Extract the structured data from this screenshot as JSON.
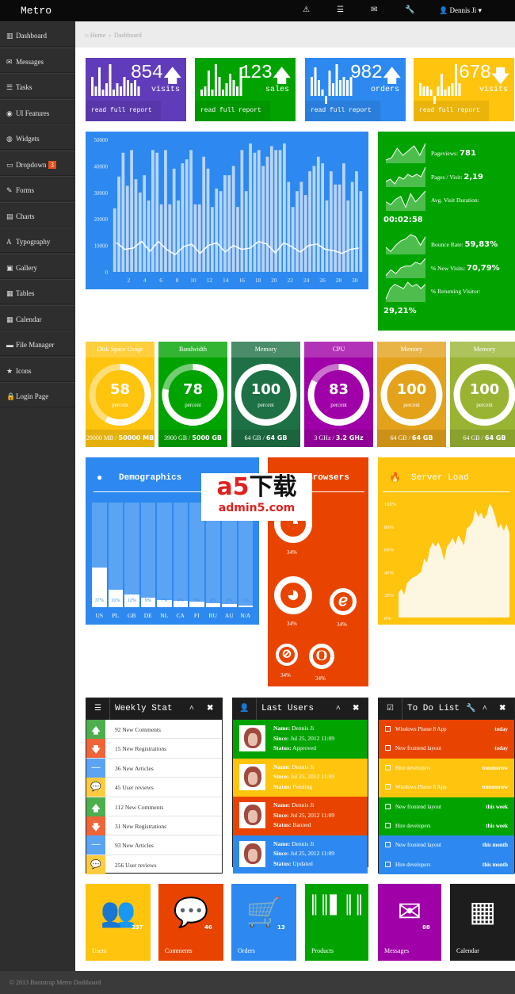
{
  "topbar": {
    "brand": "Metro",
    "icons": [
      "warning-icon",
      "tasks-icon",
      "envelope-icon",
      "wrench-icon"
    ],
    "user": "Dennis Ji"
  },
  "sidebar": {
    "items": [
      {
        "label": "Dashboard",
        "icon": "▥"
      },
      {
        "label": "Messages",
        "icon": "✉"
      },
      {
        "label": "Tasks",
        "icon": "☰"
      },
      {
        "label": "UI Features",
        "icon": "◉"
      },
      {
        "label": "Widgets",
        "icon": "◍"
      },
      {
        "label": "Dropdown",
        "icon": "▭",
        "badge": "3"
      },
      {
        "label": "Forms",
        "icon": "✎"
      },
      {
        "label": "Charts",
        "icon": "▤"
      },
      {
        "label": "Typography",
        "icon": "A"
      },
      {
        "label": "Gallery",
        "icon": "▣"
      },
      {
        "label": "Tables",
        "icon": "▦"
      },
      {
        "label": "Calendar",
        "icon": "▦"
      },
      {
        "label": "File Manager",
        "icon": "▬"
      },
      {
        "label": "Icons",
        "icon": "★"
      },
      {
        "label": "Login Page",
        "icon": "🔒"
      }
    ]
  },
  "breadcrumb": {
    "home": "Home",
    "current": "Dashboard"
  },
  "stats": [
    {
      "value": "854",
      "label": "visits",
      "trend": "up",
      "report": "read full report",
      "color": "#603cba",
      "spark": [
        6,
        3,
        9,
        2,
        4,
        10,
        2,
        4,
        3,
        6,
        5,
        4,
        5,
        3
      ]
    },
    {
      "value": "123",
      "label": "sales",
      "trend": "up",
      "report": "read full report",
      "color": "#00a300",
      "spark": [
        2,
        3,
        8,
        2,
        10,
        6,
        2,
        4,
        7,
        5,
        3,
        9
      ]
    },
    {
      "value": "982",
      "label": "orders",
      "trend": "up",
      "report": "read full report",
      "color": "#2d89ef",
      "spark": [
        6,
        9,
        5,
        2,
        -3,
        8,
        4,
        10,
        5,
        6,
        5,
        6
      ]
    },
    {
      "value": "678",
      "label": "visits",
      "trend": "down",
      "report": "read full report",
      "color": "#ffc40d",
      "spark": [
        4,
        3,
        3,
        2,
        -4,
        3,
        7,
        2,
        3,
        4,
        10,
        4
      ]
    }
  ],
  "chart_data": {
    "type": "bar",
    "xlim": [
      0,
      31
    ],
    "ylim": [
      0,
      50000
    ],
    "yticks": [
      0,
      10000,
      20000,
      30000,
      40000,
      50000
    ],
    "xticks": [
      2,
      4,
      6,
      8,
      10,
      12,
      14,
      16,
      18,
      20,
      22,
      24,
      26,
      28,
      30
    ],
    "grid": false,
    "bars": [
      24000,
      36000,
      45000,
      32500,
      46000,
      35000,
      30000,
      36500,
      27000,
      46000,
      45000,
      25500,
      46000,
      25500,
      39000,
      27000,
      41000,
      42500,
      46000,
      25500,
      25500,
      43500,
      39000,
      24500,
      31500,
      30500,
      36500,
      36500,
      40000,
      24500,
      46000,
      30500,
      48500,
      45000,
      46000,
      40000,
      43500,
      47500,
      46000,
      46000,
      48500,
      34000,
      24500,
      30500,
      34000,
      29000,
      38000,
      40000,
      43500,
      41000,
      27000,
      38000,
      33000,
      33000,
      41000,
      27000,
      34000,
      38000,
      30500
    ],
    "line": [
      11000,
      8500,
      9000,
      11500,
      7800,
      11500,
      8500,
      6500,
      9500,
      10500,
      7000,
      10000,
      11000,
      7500,
      10000,
      8500,
      9000,
      11500,
      10500,
      7200,
      11000,
      9500,
      7500,
      10000,
      10500,
      8500,
      8000,
      7000,
      8500,
      9000
    ]
  },
  "visits": [
    {
      "label": "Pageviews:",
      "value": "781",
      "spark": [
        1,
        2,
        6,
        3,
        5,
        7,
        3,
        8
      ]
    },
    {
      "label": "Pages / Visit:",
      "value": "2,19",
      "spark": [
        2,
        3,
        1,
        4,
        3,
        5,
        4,
        5,
        4,
        8
      ]
    },
    {
      "label": "Avg. Visit Duration:",
      "value": "00:02:58",
      "spark": [
        3,
        2,
        4,
        5,
        1,
        6,
        3,
        5,
        7
      ]
    },
    {
      "label": "Bounce Rate:",
      "value": "59,83%",
      "spark": [
        3,
        1,
        4,
        6,
        7,
        9,
        8,
        4,
        8
      ]
    },
    {
      "label": "% New Visits:",
      "value": "70,79%",
      "spark": [
        1,
        4,
        2,
        5,
        6,
        6,
        8,
        7,
        10
      ]
    },
    {
      "label": "% Returning Visitor:",
      "value": "29,21%",
      "spark": [
        1,
        6,
        8,
        7,
        6,
        9,
        7,
        8,
        6,
        8
      ]
    }
  ],
  "gauges": [
    {
      "title": "Disk Space Usage",
      "value": 58,
      "unit": "percent",
      "used": "29000 MB",
      "total": "50000 MB",
      "color": "#ffc40d"
    },
    {
      "title": "Bandwidth",
      "value": 78,
      "unit": "percent",
      "used": "3900 GB",
      "total": "5000 GB",
      "color": "#00a300"
    },
    {
      "title": "Memory",
      "value": 100,
      "unit": "percent",
      "used": "64 GB",
      "total": "64 GB",
      "color": "#1e7145"
    },
    {
      "title": "CPU",
      "value": 83,
      "unit": "percent",
      "used": "3 GHz",
      "total": "3.2 GHz",
      "color": "#9f00a7"
    },
    {
      "title": "Memory",
      "value": 100,
      "unit": "percent",
      "used": "64 GB",
      "total": "64 GB",
      "color": "#e3a21a"
    },
    {
      "title": "Memory",
      "value": 100,
      "unit": "percent",
      "used": "64 GB",
      "total": "64 GB",
      "color": "#99b433"
    }
  ],
  "demographics": {
    "title": "Demographics",
    "countries": [
      "US",
      "PL",
      "GB",
      "DE",
      "NL",
      "CA",
      "FI",
      "RU",
      "AU",
      "N/A"
    ],
    "values": [
      37,
      16,
      12,
      9,
      7,
      6,
      5,
      4,
      3,
      1
    ],
    "labels": [
      "37%",
      "16%",
      "12%",
      "9%",
      "7%",
      "6%",
      "5%",
      "4%",
      "3%",
      "1%"
    ]
  },
  "browsers": {
    "title": "Browsers",
    "items": [
      {
        "name": "chrome-icon",
        "value": "34%"
      },
      {
        "name": "firefox-icon",
        "value": "34%"
      },
      {
        "name": "ie-icon",
        "value": "34%"
      },
      {
        "name": "safari-icon",
        "value": "34%"
      },
      {
        "name": "opera-icon",
        "value": "34%"
      }
    ]
  },
  "server_load": {
    "title": "Server Load",
    "yticks": [
      "0%",
      "20%",
      "40%",
      "60%",
      "80%",
      "100%"
    ],
    "values": [
      22,
      25,
      20,
      30,
      33,
      35,
      36,
      38,
      40,
      52,
      48,
      60,
      66,
      62,
      66,
      60,
      50,
      62,
      65,
      70,
      64,
      72,
      68,
      63,
      78,
      80,
      84,
      95,
      88,
      92,
      86,
      90,
      100,
      96,
      88,
      78,
      82,
      76,
      82,
      74
    ]
  },
  "weekly": {
    "title": "Weekly Stat",
    "rows": [
      {
        "icon": "up",
        "text": "92 New Comments"
      },
      {
        "icon": "down",
        "text": "15 New Registrations"
      },
      {
        "icon": "minus",
        "text": "36 New Articles"
      },
      {
        "icon": "comment",
        "text": "45 User reviews"
      },
      {
        "icon": "up",
        "text": "112 New Comments"
      },
      {
        "icon": "down",
        "text": "31 New Registrations"
      },
      {
        "icon": "minus",
        "text": "93 New Articles"
      },
      {
        "icon": "comment",
        "text": "256 User reviews"
      }
    ]
  },
  "users": {
    "title": "Last Users",
    "name_label": "Name:",
    "since_label": "Since:",
    "status_label": "Status:",
    "rows": [
      {
        "name": "Dennis Ji",
        "since": "Jul 25, 2012 11:09",
        "status": "Approved",
        "color": "#00a300"
      },
      {
        "name": "Dennis Ji",
        "since": "Jul 25, 2012 11:09",
        "status": "Pending",
        "color": "#ffc40d"
      },
      {
        "name": "Dennis Ji",
        "since": "Jul 25, 2012 11:09",
        "status": "Banned",
        "color": "#e84400"
      },
      {
        "name": "Dennis Ji",
        "since": "Jul 25, 2012 11:09",
        "status": "Updated",
        "color": "#2d89ef"
      }
    ]
  },
  "todo": {
    "title": "To Do List",
    "rows": [
      {
        "text": "Windows Phone 8 App",
        "when": "today",
        "color": "#e84400"
      },
      {
        "text": "New frontend layout",
        "when": "today",
        "color": "#e84400"
      },
      {
        "text": "Hire developers",
        "when": "tommorow",
        "color": "#ffc40d"
      },
      {
        "text": "Windows Phone 8 App",
        "when": "tommorow",
        "color": "#ffc40d"
      },
      {
        "text": "New frontend layout",
        "when": "this week",
        "color": "#00a300"
      },
      {
        "text": "Hire developers",
        "when": "this week",
        "color": "#00a300"
      },
      {
        "text": "New frontend layout",
        "when": "this month",
        "color": "#2d89ef"
      },
      {
        "text": "Hire developers",
        "when": "this month",
        "color": "#2d89ef"
      }
    ]
  },
  "tiles": [
    {
      "label": "Users",
      "count": "237",
      "icon": "users-icon",
      "color": "#ffc40d"
    },
    {
      "label": "Comments",
      "count": "46",
      "icon": "comments-icon",
      "color": "#e84400"
    },
    {
      "label": "Orders",
      "count": "13",
      "icon": "cart-icon",
      "color": "#2d89ef"
    },
    {
      "label": "Products",
      "count": "",
      "icon": "barcode-icon",
      "color": "#00a300"
    },
    {
      "label": "Messages",
      "count": "88",
      "icon": "envelope-icon",
      "color": "#9f00a7"
    },
    {
      "label": "Calendar",
      "count": "",
      "icon": "calendar-icon",
      "color": "#1d1d1d"
    }
  ],
  "watermark": {
    "logo": "a5下载",
    "site": "admin5.com"
  },
  "footer": "© 2013 Bootstrap Metro Dashboard"
}
